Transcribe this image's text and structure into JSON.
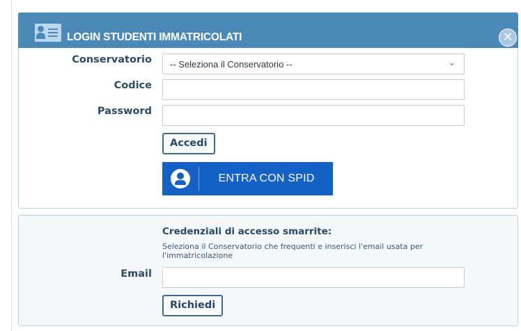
{
  "login": {
    "title": "LOGIN STUDENTI IMMATRICOLATI",
    "close_glyph": "✕",
    "conservatorio_label": "Conservatorio",
    "conservatorio_value": "-- Seleziona il Conservatorio --",
    "codice_label": "Codice",
    "codice_value": "",
    "password_label": "Password",
    "password_value": "",
    "accedi_label": "Accedi",
    "spid_label": "ENTRA CON SPID"
  },
  "recover": {
    "title": "Credenziali di accesso smarrite:",
    "description": "Seleziona il Conservatorio che frequenti e inserisci l'email usata per l'immatricolazione",
    "email_label": "Email",
    "email_value": "",
    "richiedi_label": "Richiedi"
  },
  "icons": {
    "title": "user-card-icon",
    "close": "close-icon",
    "select": "chevron-down-icon",
    "spid": "user-circle-icon"
  },
  "colors": {
    "header_bg": "#4b8ab8",
    "spid_bg": "#1562c6",
    "panel_border": "#b8d0e3"
  }
}
